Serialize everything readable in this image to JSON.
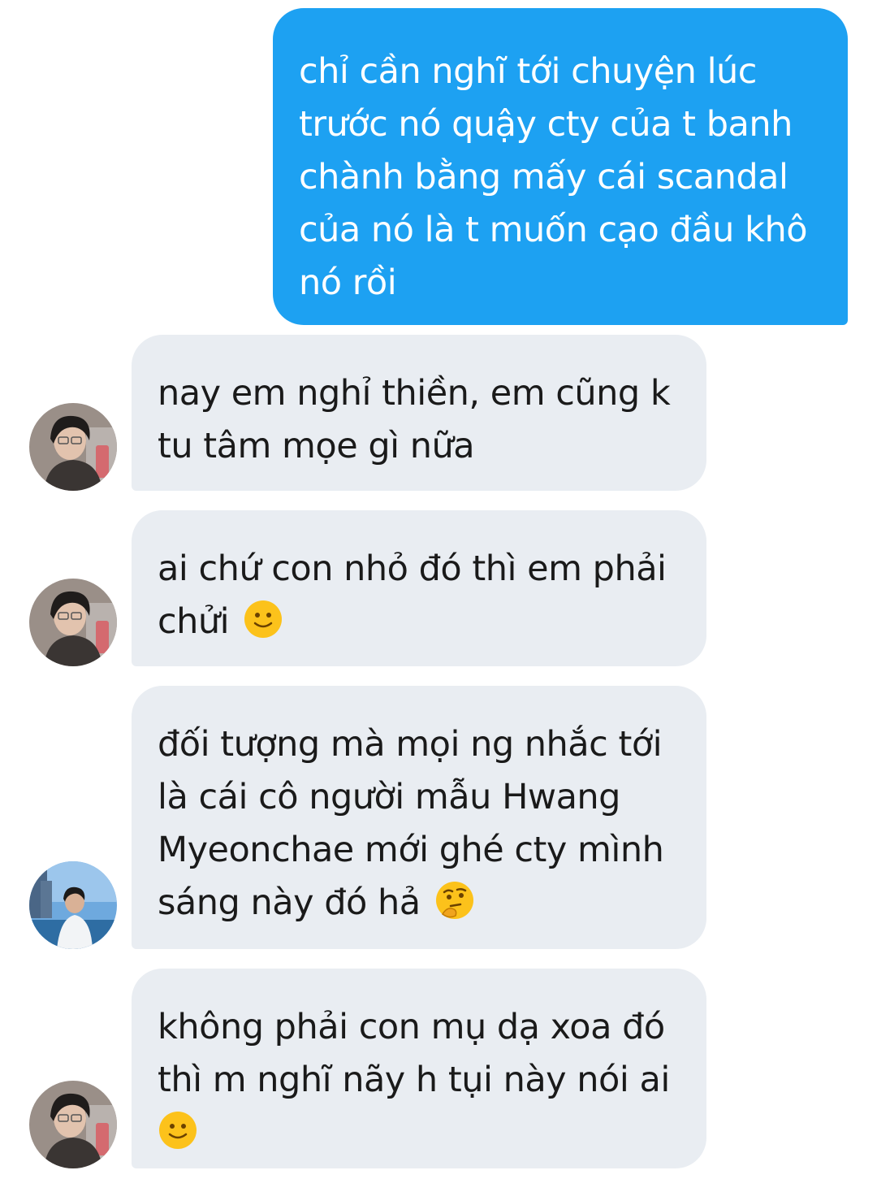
{
  "messages": [
    {
      "side": "sent",
      "text": "chỉ cần nghĩ tới chuyện lúc trước nó quậy cty của t banh chành bằng mấy cái scandal của nó là t muốn cạo đầu khô nó rồi"
    },
    {
      "side": "received",
      "text": "nay em nghỉ thiền, em cũng k tu tâm mọe gì nữa",
      "avatar": "avatar-a"
    },
    {
      "side": "received",
      "text": "ai chứ con nhỏ đó thì em phải chửi",
      "emoji": "slightly-smiling-face-emoji",
      "avatar": "avatar-a"
    },
    {
      "side": "received",
      "text": "đối tượng mà mọi ng nhắc tới là cái cô người mẫu Hwang Myeonchae mới ghé cty mình sáng này đó hả",
      "emoji": "thinking-face-emoji",
      "avatar": "avatar-b"
    },
    {
      "side": "received",
      "text": "không phải con mụ dạ xoa đó thì m nghĩ nãy h tụi này nói ai",
      "emoji": "slightly-smiling-face-emoji",
      "avatar": "avatar-a"
    }
  ],
  "colors": {
    "sent_bubble": "#1da1f2",
    "received_bubble": "#e9edf2",
    "sent_text": "#ffffff",
    "received_text": "#1a1a1a"
  }
}
